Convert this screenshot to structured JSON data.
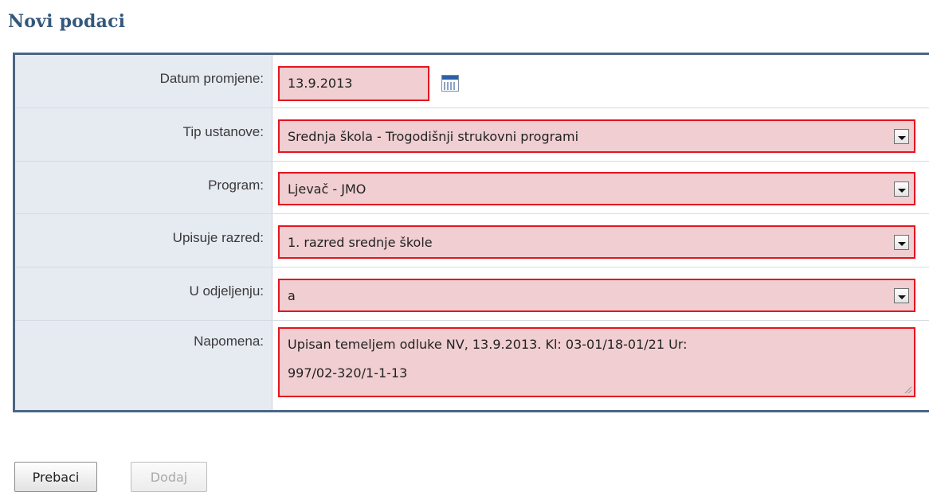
{
  "page_title": "Novi podaci",
  "colors": {
    "title": "#34587c",
    "field_bg": "#f0ced1",
    "field_border": "#e6141f",
    "label_bg": "#e6eaf1"
  },
  "form": {
    "date": {
      "label": "Datum promjene:",
      "value": "13.9.2013",
      "icon": "calendar-icon"
    },
    "institution_type": {
      "label": "Tip ustanove:",
      "value": "Srednja škola - Trogodišnji strukovni programi"
    },
    "program": {
      "label": "Program:",
      "value": "Ljevač - JMO"
    },
    "grade": {
      "label": "Upisuje razred:",
      "value": "1. razred srednje škole"
    },
    "class": {
      "label": "U odjeljenju:",
      "value": "a"
    },
    "note": {
      "label": "Napomena:",
      "line1": "Upisan temeljem odluke NV, 13.9.2013. Kl: 03-01/18-01/21 Ur:",
      "line2": "997/02-320/1-1-13"
    }
  },
  "buttons": {
    "transfer": "Prebaci",
    "add": "Dodaj"
  }
}
